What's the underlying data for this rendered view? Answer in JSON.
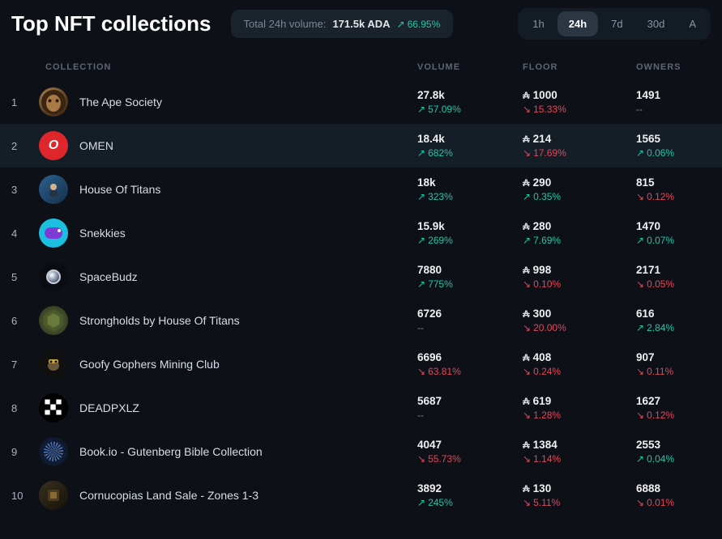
{
  "header": {
    "title": "Top NFT collections",
    "total_label": "Total 24h volume:",
    "total_value": "171.5k ADA",
    "total_pct": "66.95%"
  },
  "time_tabs": [
    "1h",
    "24h",
    "7d",
    "30d",
    "A"
  ],
  "time_active": "24h",
  "columns": {
    "collection": "COLLECTION",
    "volume": "VOLUME",
    "floor": "FLOOR",
    "owners": "OWNERS"
  },
  "rows": [
    {
      "rank": "1",
      "name": "The Ape Society",
      "avatar": "ape",
      "volume": "27.8k",
      "volume_pct": "57.09%",
      "volume_dir": "up",
      "floor": "1000",
      "floor_pct": "15.33%",
      "floor_dir": "down",
      "owners": "1491",
      "owners_pct": "--",
      "owners_dir": "none"
    },
    {
      "rank": "2",
      "name": "OMEN",
      "avatar": "omen",
      "volume": "18.4k",
      "volume_pct": "682%",
      "volume_dir": "up",
      "floor": "214",
      "floor_pct": "17.69%",
      "floor_dir": "down",
      "owners": "1565",
      "owners_pct": "0.06%",
      "owners_dir": "up",
      "hover": true
    },
    {
      "rank": "3",
      "name": "House Of Titans",
      "avatar": "titans",
      "volume": "18k",
      "volume_pct": "323%",
      "volume_dir": "up",
      "floor": "290",
      "floor_pct": "0.35%",
      "floor_dir": "up",
      "owners": "815",
      "owners_pct": "0.12%",
      "owners_dir": "down"
    },
    {
      "rank": "4",
      "name": "Snekkies",
      "avatar": "snek",
      "volume": "15.9k",
      "volume_pct": "269%",
      "volume_dir": "up",
      "floor": "280",
      "floor_pct": "7.69%",
      "floor_dir": "up",
      "owners": "1470",
      "owners_pct": "0.07%",
      "owners_dir": "up"
    },
    {
      "rank": "5",
      "name": "SpaceBudz",
      "avatar": "space",
      "volume": "7880",
      "volume_pct": "775%",
      "volume_dir": "up",
      "floor": "998",
      "floor_pct": "0.10%",
      "floor_dir": "down",
      "owners": "2171",
      "owners_pct": "0.05%",
      "owners_dir": "down"
    },
    {
      "rank": "6",
      "name": "Strongholds by House Of Titans",
      "avatar": "strong",
      "volume": "6726",
      "volume_pct": "--",
      "volume_dir": "none",
      "floor": "300",
      "floor_pct": "20.00%",
      "floor_dir": "down",
      "owners": "616",
      "owners_pct": "2.84%",
      "owners_dir": "up"
    },
    {
      "rank": "7",
      "name": "Goofy Gophers Mining Club",
      "avatar": "goofy",
      "volume": "6696",
      "volume_pct": "63.81%",
      "volume_dir": "down",
      "floor": "408",
      "floor_pct": "0.24%",
      "floor_dir": "down",
      "owners": "907",
      "owners_pct": "0.11%",
      "owners_dir": "down"
    },
    {
      "rank": "8",
      "name": "DEADPXLZ",
      "avatar": "dead",
      "volume": "5687",
      "volume_pct": "--",
      "volume_dir": "none",
      "floor": "619",
      "floor_pct": "1.28%",
      "floor_dir": "down",
      "owners": "1627",
      "owners_pct": "0.12%",
      "owners_dir": "down"
    },
    {
      "rank": "9",
      "name": "Book.io - Gutenberg Bible Collection",
      "avatar": "book",
      "volume": "4047",
      "volume_pct": "55.73%",
      "volume_dir": "down",
      "floor": "1384",
      "floor_pct": "1.14%",
      "floor_dir": "down",
      "owners": "2553",
      "owners_pct": "0.04%",
      "owners_dir": "up"
    },
    {
      "rank": "10",
      "name": "Cornucopias Land Sale - Zones 1-3",
      "avatar": "corn",
      "volume": "3892",
      "volume_pct": "245%",
      "volume_dir": "up",
      "floor": "130",
      "floor_pct": "5.11%",
      "floor_dir": "down",
      "owners": "6888",
      "owners_pct": "0.01%",
      "owners_dir": "down"
    }
  ]
}
